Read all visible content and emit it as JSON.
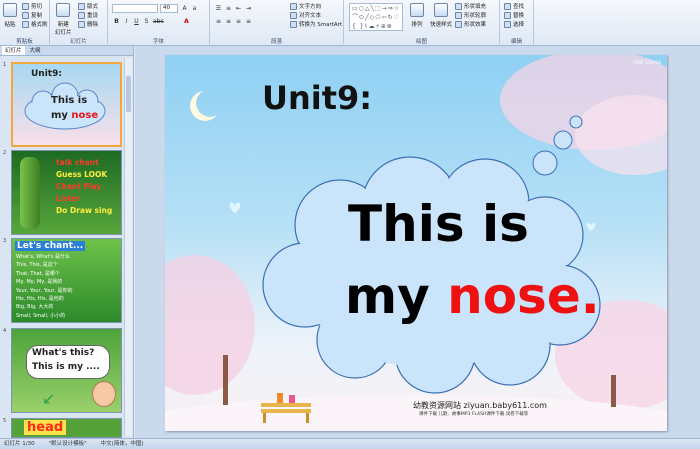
{
  "ribbon": {
    "clipboard": {
      "paste": "粘贴",
      "cut": "剪切",
      "copy": "复制",
      "format_painter": "格式刷",
      "label": "剪贴板"
    },
    "slides": {
      "new_slide": "新建\n幻灯片",
      "layout": "版式",
      "reset": "重设",
      "delete": "删除",
      "label": "幻灯片"
    },
    "font": {
      "size": "40",
      "label": "字体"
    },
    "paragraph": {
      "text_direction": "文字方向",
      "align_text": "对齐文本",
      "smartart": "转换为 SmartArt",
      "label": "段落"
    },
    "drawing": {
      "arrange": "排列",
      "quick_styles": "快速样式",
      "shape_fill": "形状填充",
      "shape_outline": "形状轮廓",
      "shape_effects": "形状效果",
      "label": "绘图"
    },
    "editing": {
      "find": "查找",
      "replace": "替换",
      "select": "选择",
      "label": "编辑"
    }
  },
  "panel": {
    "tabs": [
      "幻灯片",
      "大纲"
    ],
    "slide_numbers": [
      "1",
      "2",
      "3",
      "4",
      "5"
    ],
    "thumb1": {
      "unit": "Unit9:",
      "line1": "This is",
      "line2a": "my ",
      "line2b": "nose"
    },
    "thumb2": {
      "words": [
        "talk chant",
        "Guess LOOK",
        "Chant Play Lister",
        "Do Draw sing"
      ]
    },
    "thumb3": {
      "title": "Let's chant...",
      "lines": [
        "What's, What's 是什么",
        "This, This, 是这个",
        "That, That, 是哪个",
        "My, My, My, 是我的",
        "Your, Your, Your, 是你的",
        "His, His, His, 是他的",
        "Big, Big, 大大的",
        "Small, Small, 小小的"
      ]
    },
    "thumb4": {
      "line1": "What's this?",
      "line2": "This is my ...."
    },
    "thumb5": {
      "text": "head"
    }
  },
  "slide": {
    "unit": "Unit9:",
    "line1": "This is",
    "line2a": "my ",
    "line2b": "nose",
    "line2c": ".",
    "site": "幼教资源网站  ziyuan.baby611.com",
    "site_sub": "课件下载  儿歌、故事MP3  FLASH课件下载  试卷下载等",
    "corner_mark": "Hot Lions"
  },
  "status": {
    "slide_info": "幻灯片 1/30",
    "theme": "\"默认设计模板\"",
    "language": "中文(简体，中国)"
  },
  "colors": {
    "accent_red": "#e11111",
    "cloud_fill": "#c9e4fb"
  }
}
